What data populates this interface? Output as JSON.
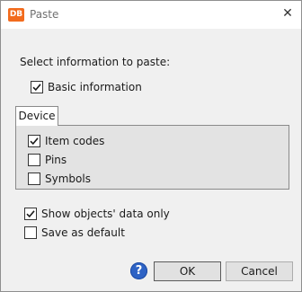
{
  "window": {
    "app_icon_text": "DB",
    "title": "Paste",
    "close_glyph": "✕"
  },
  "content": {
    "prompt": "Select information to paste:",
    "basic_information": {
      "label": "Basic information",
      "checked": true
    }
  },
  "tabs": [
    {
      "label": "Device",
      "selected": true
    }
  ],
  "device_group": {
    "items": [
      {
        "label": "Item codes",
        "checked": true
      },
      {
        "label": "Pins",
        "checked": false
      },
      {
        "label": "Symbols",
        "checked": false
      }
    ]
  },
  "options": {
    "show_objects_data_only": {
      "label": "Show objects' data only",
      "checked": true
    },
    "save_as_default": {
      "label": "Save as default",
      "checked": false
    }
  },
  "footer": {
    "help_icon": "question-circle-icon",
    "help_glyph": "?",
    "ok_label": "OK",
    "cancel_label": "Cancel"
  },
  "colors": {
    "app_icon_bg": "#f26b1d",
    "help_icon_bg": "#2e63c5",
    "dialog_bg": "#f0f0f0"
  }
}
